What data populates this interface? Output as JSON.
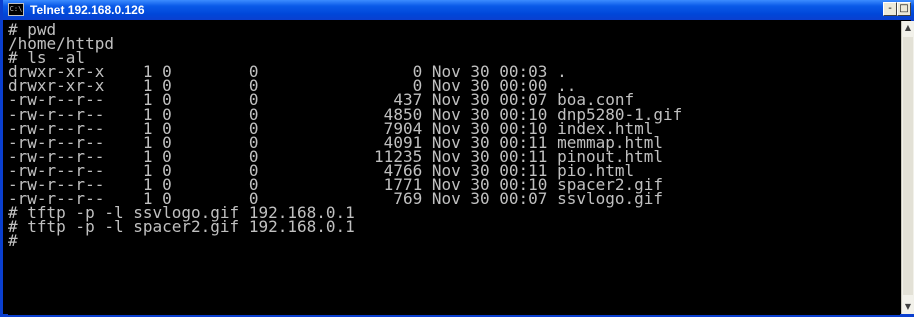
{
  "window": {
    "title": "Telnet 192.168.0.126",
    "icon_glyph": "C:\\",
    "controls": {
      "minimize": "-",
      "maximize": "□"
    }
  },
  "scrollbar": {
    "up": "▲",
    "down": "▼"
  },
  "console": {
    "text": "# pwd\n/home/httpd\n# ls -al\ndrwxr-xr-x    1 0        0                0 Nov 30 00:03 .\ndrwxr-xr-x    1 0        0                0 Nov 30 00:00 ..\n-rw-r--r--    1 0        0              437 Nov 30 00:07 boa.conf\n-rw-r--r--    1 0        0             4850 Nov 30 00:10 dnp5280-1.gif\n-rw-r--r--    1 0        0             7904 Nov 30 00:10 index.html\n-rw-r--r--    1 0        0             4091 Nov 30 00:11 memmap.html\n-rw-r--r--    1 0        0            11235 Nov 30 00:11 pinout.html\n-rw-r--r--    1 0        0             4766 Nov 30 00:11 pio.html\n-rw-r--r--    1 0        0             1771 Nov 30 00:10 spacer2.gif\n-rw-r--r--    1 0        0              769 Nov 30 00:07 ssvlogo.gif\n# tftp -p -l ssvlogo.gif 192.168.0.1\n# tftp -p -l spacer2.gif 192.168.0.1\n#"
  }
}
